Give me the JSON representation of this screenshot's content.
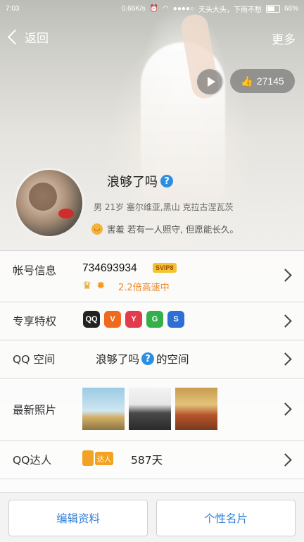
{
  "status_bar": {
    "time": "7:03",
    "network_speed": "0.66K/s",
    "carrier": "天头大头，下雨不愁",
    "battery": "66%"
  },
  "nav": {
    "back_label": "返回",
    "more_label": "更多"
  },
  "likes": {
    "count": "27145"
  },
  "profile": {
    "nickname": "浪够了吗",
    "qmark": "?",
    "info": "男 21岁 塞尔维亚,黑山 克拉古涅瓦茨",
    "signature": "害羞 若有一人照守, 但愿能长久。"
  },
  "list": {
    "account": {
      "label": "帐号信息",
      "number": "734693934",
      "svip": "SVIP8",
      "speed": "2.2倍高速中"
    },
    "privileges": {
      "label": "专享特权",
      "badges": [
        "QQ",
        "V",
        "Y",
        "G",
        "S"
      ]
    },
    "space": {
      "label": "QQ 空间",
      "name_prefix": "浪够了吗",
      "qmark": "?",
      "suffix": "的空间"
    },
    "photos": {
      "label": "最新照片"
    },
    "daren": {
      "label": "QQ达人",
      "badge": "达人",
      "days": "587天"
    }
  },
  "bottom": {
    "edit_label": "编辑资料",
    "card_label": "个性名片"
  }
}
